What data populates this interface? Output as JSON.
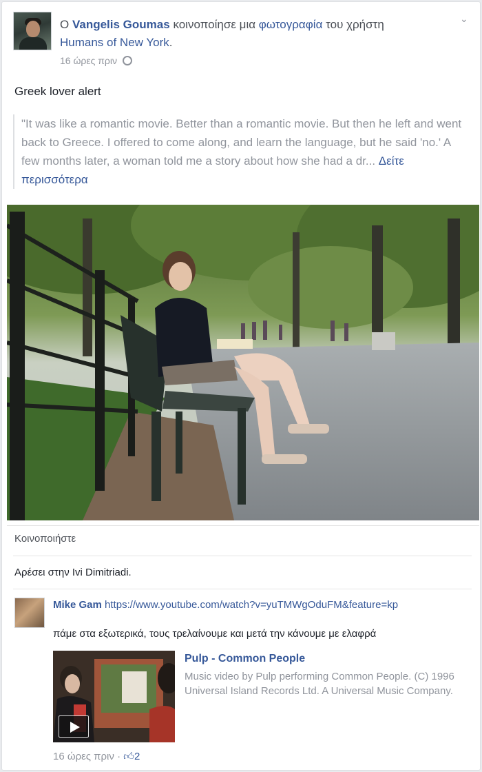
{
  "post": {
    "prefix": "Ο",
    "author": "Vangelis Goumas",
    "action": "κοινοποίησε μια",
    "object": "φωτογραφία",
    "of_user": "του χρήστη",
    "page": "Humans of New York",
    "page_suffix": ".",
    "time": "16 ώρες πριν",
    "privacy_icon": "globe-icon",
    "text": "Greek lover alert",
    "quote": "\"It was like a romantic movie. Better than a romantic movie. But then he left and went back to Greece. I offered to come along, and learn the language, but he said 'no.' A few months later, a woman told me a story about how she had a dr...",
    "see_more": "Δείτε περισσότερα"
  },
  "actions": {
    "share": "Κοινοποιήστε"
  },
  "likes": {
    "text": "Αρέσει στην Ivi Dimitriadi."
  },
  "comment": {
    "author": "Mike Gam",
    "url": "https://www.youtube.com/watch?v=yuTMWgOduFM&feature=kp",
    "text": "πάμε στα εξωτερικά, τους τρελαίνουμε και μετά την κάνουμε με ελαφρά",
    "attachment": {
      "title": "Pulp - Common People",
      "description": "Music video by Pulp performing Common People. (C) 1996 Universal Island Records Ltd. A Universal Music Company."
    },
    "time": "16 ώρες πριν",
    "separator": "·",
    "like_count": "2"
  },
  "colors": {
    "link": "#365899",
    "muted": "#90949c",
    "text": "#1d2129"
  }
}
